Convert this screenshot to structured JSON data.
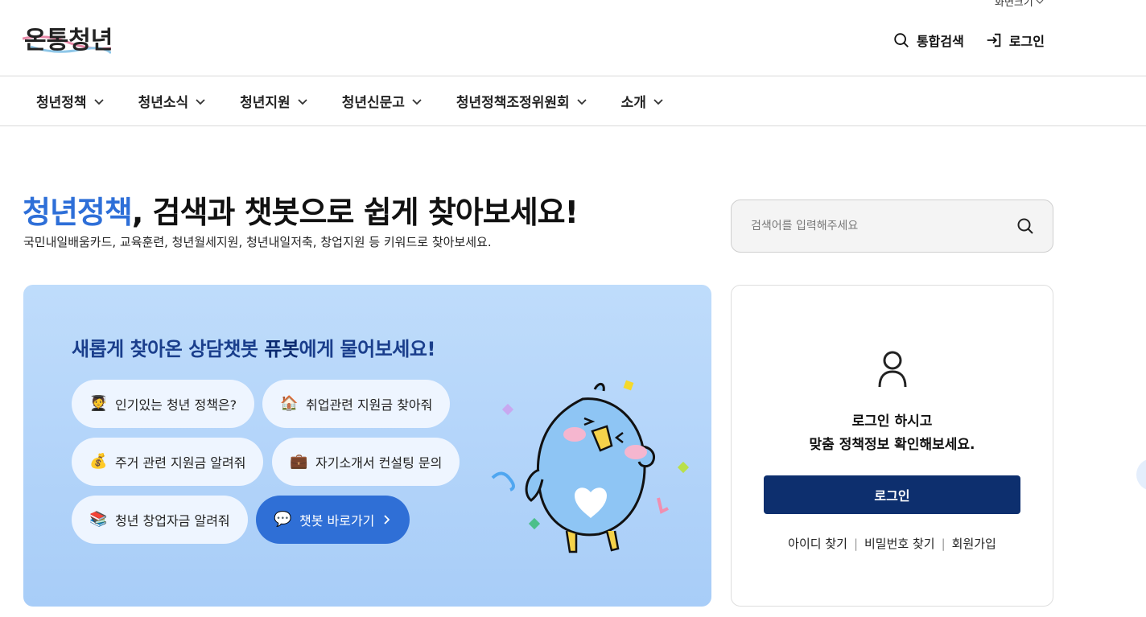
{
  "header": {
    "font_size_label": "화면크기",
    "logo_text": "온통청년",
    "search_label": "통합검색",
    "login_label": "로그인"
  },
  "nav": {
    "items": [
      {
        "label": "청년정책"
      },
      {
        "label": "청년소식"
      },
      {
        "label": "청년지원"
      },
      {
        "label": "청년신문고"
      },
      {
        "label": "청년정책조정위원회"
      },
      {
        "label": "소개"
      }
    ]
  },
  "hero": {
    "title_accent": "청년정책",
    "title_rest": ", 검색과 챗봇으로 쉽게 찾아보세요!",
    "subtitle": "국민내일배움카드, 교육훈련, 청년월세지원, 청년내일저축, 창업지원 등 키워드로 찾아보세요."
  },
  "search": {
    "placeholder": "검색어를 입력해주세요"
  },
  "chatbot": {
    "heading_pre": "새롭게 찾아온 상담챗봇 ",
    "heading_bold": "퓨봇",
    "heading_post": "에게 물어보세요!",
    "buttons": [
      {
        "label": "인기있는 청년 정책은?",
        "icon": "graduate-icon"
      },
      {
        "label": "취업관련 지원금 찾아줘",
        "icon": "house-icon"
      },
      {
        "label": "주거 관련 지원금 알려줘",
        "icon": "money-bag-icon"
      },
      {
        "label": "자기소개서 컨설팅 문의",
        "icon": "briefcase-icon"
      },
      {
        "label": "청년 창업자금 알려줘",
        "icon": "books-icon"
      }
    ],
    "go_label": "챗봇 바로가기"
  },
  "login_card": {
    "line1": "로그인 하시고",
    "line2": "맞춤 정책정보 확인해보세요.",
    "button_label": "로그인",
    "find_id": "아이디 찾기",
    "find_pw": "비밀번호 찾기",
    "signup": "회원가입"
  },
  "colors": {
    "accent_blue": "#2e6fd8",
    "navy": "#0d2f6e",
    "panel_bg": "#bfdcfb"
  }
}
